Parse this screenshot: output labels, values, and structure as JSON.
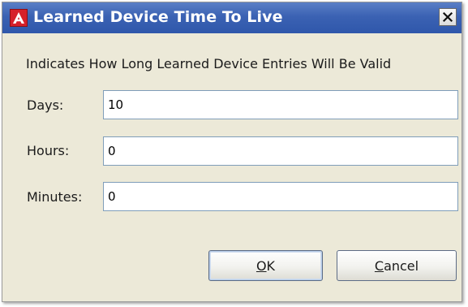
{
  "window": {
    "title": "Learned Device Time To Live",
    "app_icon": "red-triangle-logo-icon",
    "close_icon": "close-x-icon",
    "titlebar_color": "#3b62b3",
    "background": "#ece9d8"
  },
  "description": "Indicates How Long Learned Device Entries Will Be Valid",
  "fields": {
    "days": {
      "label": "Days:",
      "value": "10"
    },
    "hours": {
      "label": "Hours:",
      "value": "0"
    },
    "minutes": {
      "label": "Minutes:",
      "value": "0"
    }
  },
  "buttons": {
    "ok": {
      "mnemonic": "O",
      "rest": "K"
    },
    "cancel": {
      "mnemonic": "C",
      "rest": "ancel"
    }
  }
}
